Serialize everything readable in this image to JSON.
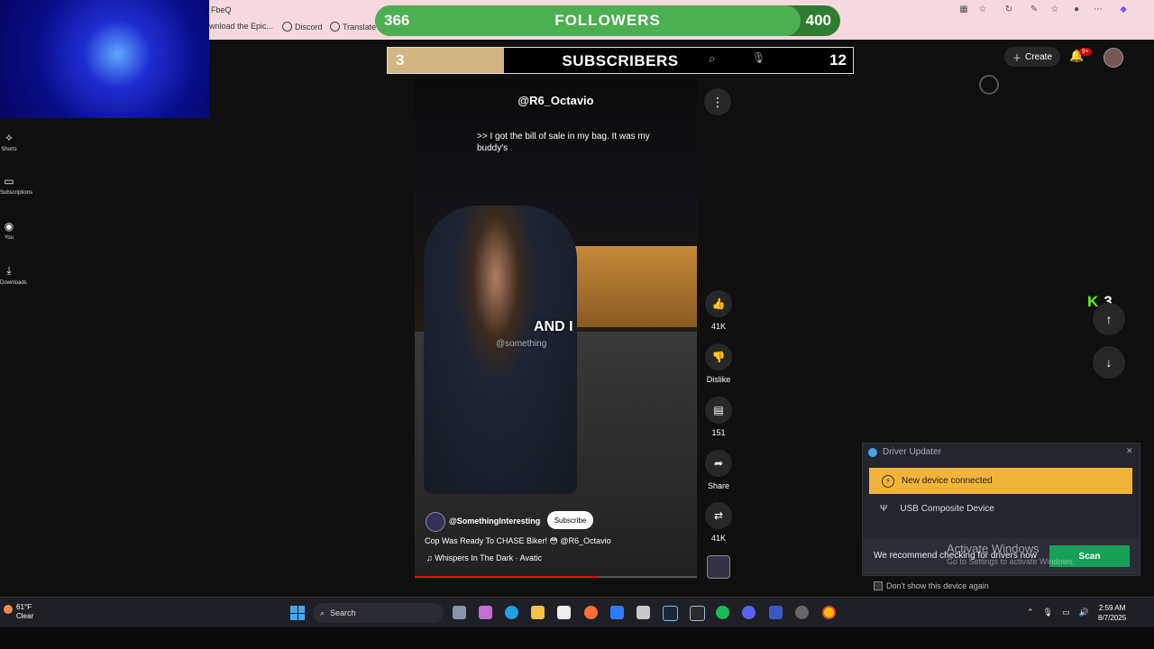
{
  "browser": {
    "tab_fragment": "FbeQ",
    "bookmarks": [
      "wnload the Epic...",
      "Discord",
      "Translate"
    ]
  },
  "overlay": {
    "followers": {
      "current": "366",
      "label": "FOLLOWERS",
      "goal": "400",
      "progress_fraction": 0.915
    },
    "subscribers": {
      "current": "3",
      "label": "SUBSCRIBERS",
      "goal": "12",
      "progress_fraction": 0.25
    }
  },
  "sidebar": {
    "items": [
      {
        "label": "Shorts",
        "icon": "shorts-icon"
      },
      {
        "label": "Subscriptions",
        "icon": "subscriptions-icon"
      },
      {
        "label": "You",
        "icon": "you-icon"
      },
      {
        "label": "Downloads",
        "icon": "download-icon"
      }
    ]
  },
  "header": {
    "create_label": "Create",
    "notifications_badge": "9+"
  },
  "video": {
    "channel_handle": "@R6_Octavio",
    "caption": ">> I got the bill of sale in my bag. It was my buddy's",
    "burned_in_text": "AND I",
    "watermark": "@something",
    "channel_name": "@SomethingInteresting",
    "subscribe_label": "Subscribe",
    "title": "Cop Was Ready To CHASE Biker! 😳 @R6_Octavio",
    "music": "Whispers In The Dark · Avatic",
    "progress_fraction": 0.65
  },
  "actions": {
    "like_count": "41K",
    "dislike_label": "Dislike",
    "comment_count": "151",
    "share_label": "Share",
    "remix_count": "41K"
  },
  "kick": {
    "count": "3"
  },
  "driver_updater": {
    "title": "Driver Updater",
    "alert": "New device connected",
    "device": "USB Composite Device",
    "recommend": "We recommend checking for drivers now",
    "scan_label": "Scan",
    "dont_show": "Don't show this device again",
    "accent_color": "#f0b43a",
    "scan_color": "#18a058"
  },
  "windows": {
    "activate_title": "Activate Windows",
    "activate_sub": "Go to Settings to activate Windows."
  },
  "taskbar": {
    "temp": "61°F",
    "condition": "Clear",
    "search_placeholder": "Search",
    "time": "2:59 AM",
    "date": "8/7/2025"
  }
}
